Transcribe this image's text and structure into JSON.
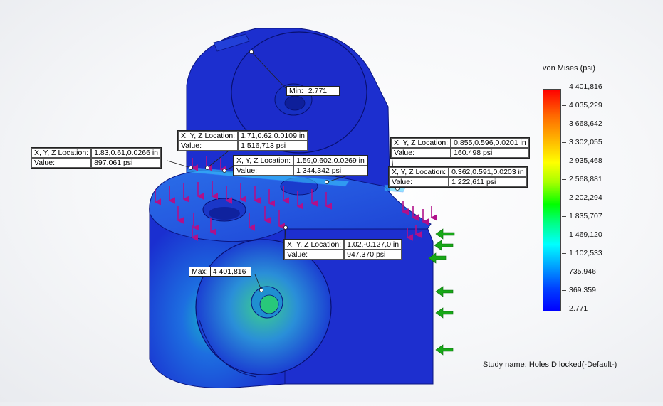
{
  "legend": {
    "title": "von Mises (psi)",
    "ticks": [
      "4 401,816",
      "4 035,229",
      "3 668,642",
      "3 302,055",
      "2 935,468",
      "2 568,881",
      "2 202,294",
      "1 835,707",
      "1 469,120",
      "1 102,533",
      "735.946",
      "369.359",
      "2.771"
    ]
  },
  "min": {
    "label": "Min:",
    "value": "2.771"
  },
  "max": {
    "label": "Max:",
    "value": "4 401,816"
  },
  "probes": [
    {
      "loc_label": "X, Y, Z Location:",
      "loc": "1.83,0.61,0.0266 in",
      "val_label": "Value:",
      "val": "897.061   psi"
    },
    {
      "loc_label": "X, Y, Z Location:",
      "loc": "1.71,0.62,0.0109 in",
      "val_label": "Value:",
      "val": "1 516,713   psi"
    },
    {
      "loc_label": "X, Y, Z Location:",
      "loc": "1.59,0.602,0.0269 in",
      "val_label": "Value:",
      "val": "1 344,342   psi"
    },
    {
      "loc_label": "X, Y, Z Location:",
      "loc": "0.855,0.596,0.0201 in",
      "val_label": "Value:",
      "val": "160.498   psi"
    },
    {
      "loc_label": "X, Y, Z Location:",
      "loc": "0.362,0.591,0.0203 in",
      "val_label": "Value:",
      "val": "1 222,611   psi"
    },
    {
      "loc_label": "X, Y, Z Location:",
      "loc": "1.02,-0.127,0 in",
      "val_label": "Value:",
      "val": "947.370   psi"
    }
  ],
  "study": "Study name: Holes D locked(-Default-)",
  "colors": {
    "part_blue": "#1a3fd0",
    "load_arrow": "#b0108a",
    "fixture_arrow": "#18a818"
  }
}
